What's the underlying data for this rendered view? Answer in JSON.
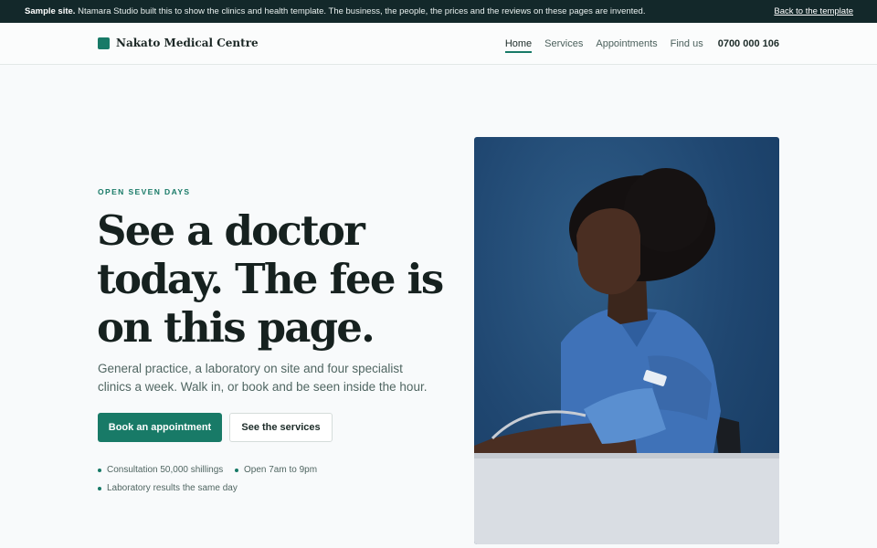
{
  "banner": {
    "bold": "Sample site.",
    "text": " Ntamara Studio built this to show the clinics and health template. The business, the people, the prices and the reviews on these pages are invented.",
    "link": "Back to the template"
  },
  "header": {
    "brand": "Nakato Medical Centre",
    "nav": [
      {
        "label": "Home",
        "active": true
      },
      {
        "label": "Services",
        "active": false
      },
      {
        "label": "Appointments",
        "active": false
      },
      {
        "label": "Find us",
        "active": false
      }
    ],
    "phone": "0700 000 106"
  },
  "hero": {
    "eyebrow": "OPEN SEVEN DAYS",
    "headline": "See a doctor today. The fee is on this page.",
    "lede": "General practice, a laboratory on site and four specialist clinics a week. Walk in, or book and be seen inside the hour.",
    "primary_button": "Book an appointment",
    "secondary_button": "See the services",
    "facts": [
      "Consultation 50,000 shillings",
      "Open 7am to 9pm",
      "Laboratory results the same day"
    ]
  },
  "colors": {
    "accent": "#187a67",
    "banner_bg": "#13282a",
    "photo_bg": "#1f4670",
    "scrubs": "#3f72b8"
  },
  "photo": {
    "subject": "nurse-with-blood-pressure-cuff"
  }
}
